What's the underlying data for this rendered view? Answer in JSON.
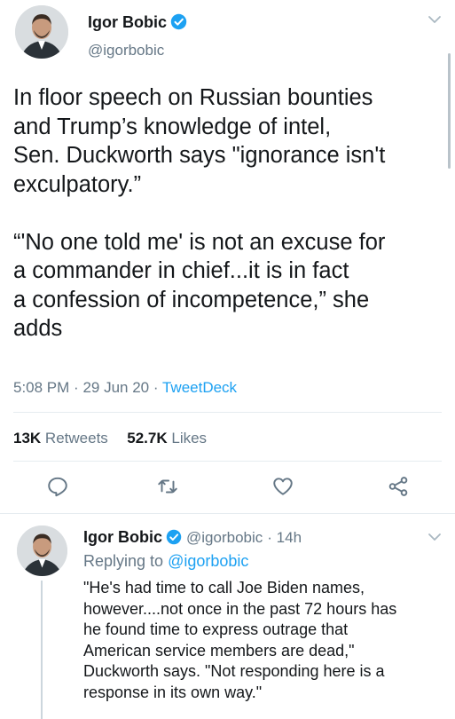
{
  "tweet": {
    "author_name": "Igor Bobic",
    "author_handle": "@igorbobic",
    "text": "In floor speech on Russian bounties\nand Trump’s knowledge of intel,\nSen. Duckworth says \"ignorance isn't\nexculpatory.”\n\n“'No one told me' is not an excuse for\na commander in chief...it is in fact\na confession of incompetence,” she\nadds",
    "time": "5:08 PM",
    "date": "29 Jun 20",
    "sep": "·",
    "client": "TweetDeck",
    "retweets_count": "13K",
    "retweets_label": "Retweets",
    "likes_count": "52.7K",
    "likes_label": "Likes"
  },
  "reply": {
    "author_name": "Igor Bobic",
    "author_handle": "@igorbobic",
    "age": "· 14h",
    "replying_prefix": "Replying to",
    "replying_handle": "@igorbobic",
    "text": "\"He's had time to call Joe Biden names,\nhowever....not once in the past 72 hours has\nhe found time to express outrage that\nAmerican service members are dead,\"\nDuckworth says. \"Not responding here is a\nresponse in its own way.\""
  },
  "icons": {
    "reply": "reply-icon",
    "retweet": "retweet-icon",
    "like": "heart-icon",
    "share": "share-icon",
    "more": "chevron-down-icon",
    "verified": "verified-badge-icon"
  },
  "colors": {
    "accent": "#1da1f2",
    "secondary_text": "#657786",
    "primary_text": "#14171a"
  }
}
